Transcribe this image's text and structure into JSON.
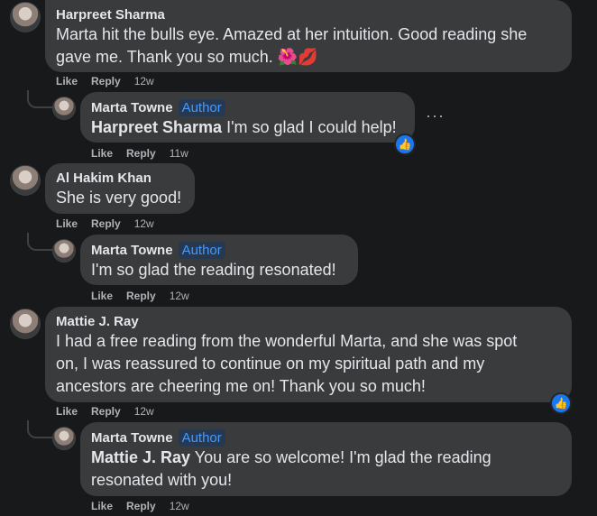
{
  "comments": [
    {
      "author": "Harpreet Sharma",
      "text": "Marta hit the bulls eye. Amazed at her intuition. Good reading she gave me. Thank you so much.",
      "text_line1": "Marta hit the bulls eye. Amazed at her intuition. Good reading she",
      "text_line2": "gave me. Thank you so much. 🌺💋",
      "actions": {
        "like": "Like",
        "reply": "Reply",
        "time": "12w"
      },
      "reply": {
        "author": "Marta Towne",
        "badge": "Author",
        "mention": "Harpreet Sharma",
        "text": " I'm so glad I could help!",
        "actions": {
          "like": "Like",
          "reply": "Reply",
          "time": "11w"
        },
        "more": "···"
      }
    },
    {
      "author": "Al Hakim Khan",
      "text": "She is very good!",
      "actions": {
        "like": "Like",
        "reply": "Reply",
        "time": "12w"
      },
      "reply": {
        "author": "Marta Towne",
        "badge": "Author",
        "text": "I'm so glad the reading resonated!",
        "actions": {
          "like": "Like",
          "reply": "Reply",
          "time": "12w"
        }
      }
    },
    {
      "author": "Mattie J. Ray",
      "text_line1": "I had a free reading from the wonderful Marta, and she was spot",
      "text_line2": "on, I was reassured to continue on my spiritual path and my",
      "text_line3": "ancestors are cheering me on! Thank you so much!",
      "actions": {
        "like": "Like",
        "reply": "Reply",
        "time": "12w"
      },
      "reply": {
        "author": "Marta Towne",
        "badge": "Author",
        "mention": "Mattie J. Ray",
        "text_line1": " You are so welcome! I'm glad the reading",
        "text_line2": "resonated with you!",
        "actions": {
          "like": "Like",
          "reply": "Reply",
          "time": "12w"
        }
      }
    }
  ],
  "colors": {
    "background": "#18191a",
    "bubble": "#3a3b3c",
    "author_badge": "#4599ff",
    "like_reaction": "#1877f2"
  },
  "icons": {
    "reaction": "thumbs-up-icon",
    "more": "more-options-icon"
  }
}
